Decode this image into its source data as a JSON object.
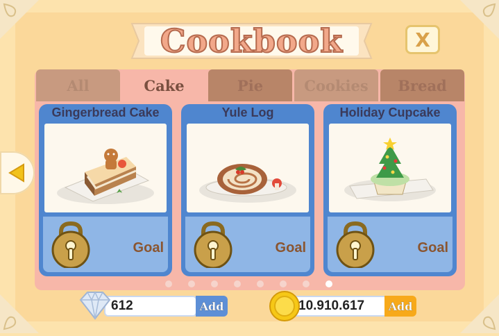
{
  "header": {
    "title": "Cookbook",
    "close_label": "X"
  },
  "tabs": [
    {
      "label": "All",
      "active": false
    },
    {
      "label": "Cake",
      "active": true
    },
    {
      "label": "Pie",
      "active": false
    },
    {
      "label": "Cookies",
      "active": false
    },
    {
      "label": "Bread",
      "active": false
    }
  ],
  "recipes": [
    {
      "name": "Gingerbread Cake",
      "status": "Goal",
      "icon": "gingerbread-cake-icon"
    },
    {
      "name": "Yule Log",
      "status": "Goal",
      "icon": "yule-log-icon"
    },
    {
      "name": "Holiday Cupcake",
      "status": "Goal",
      "icon": "holiday-cupcake-icon"
    }
  ],
  "pagination": {
    "total": 8,
    "current": 8
  },
  "currency": {
    "gems": {
      "value": "612",
      "add_label": "Add"
    },
    "coins": {
      "value": "10.910.617",
      "add_label": "Add"
    }
  },
  "colors": {
    "background": "#fde3ad",
    "panel": "#f7b7a9",
    "card": "#4f86cf",
    "tab": "#b88568",
    "goal_text": "#8a5530"
  }
}
